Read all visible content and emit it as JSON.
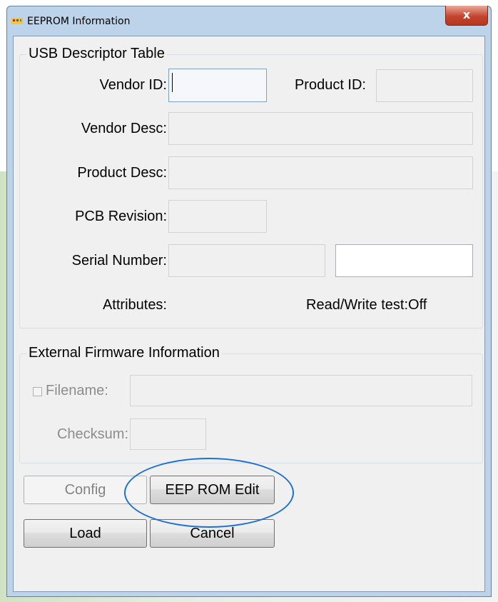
{
  "window": {
    "title": "EEPROM Information",
    "close_label": "x"
  },
  "usb": {
    "group_label": "USB Descriptor Table",
    "vendor_id_label": "Vendor ID:",
    "vendor_id_value": "",
    "product_id_label": "Product ID:",
    "product_id_value": "",
    "vendor_desc_label": "Vendor Desc:",
    "vendor_desc_value": "",
    "product_desc_label": "Product Desc:",
    "product_desc_value": "",
    "pcb_revision_label": "PCB Revision:",
    "pcb_revision_value": "",
    "serial_number_label": "Serial Number:",
    "serial_number_value": "",
    "serial_number_extra_value": "",
    "attributes_label": "Attributes:",
    "rw_test_label": "Read/Write test:Off"
  },
  "firmware": {
    "group_label": "External Firmware Information",
    "filename_label": "Filename:",
    "filename_checked": false,
    "filename_value": "",
    "checksum_label": "Checksum:",
    "checksum_value": ""
  },
  "buttons": {
    "config": "Config",
    "eeprom_edit": "EEP ROM Edit",
    "load": "Load",
    "cancel": "Cancel"
  },
  "annotation": {
    "highlight_color": "#1c6fd6",
    "highlight_target": "eeprom-edit-button"
  }
}
